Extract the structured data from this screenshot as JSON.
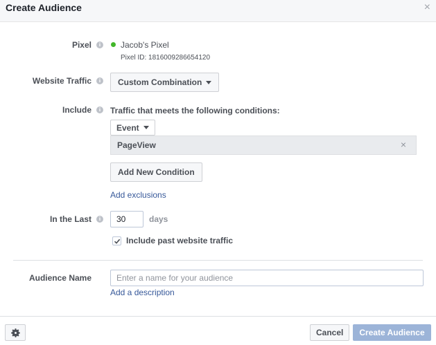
{
  "dialog": {
    "title": "Create Audience",
    "close_glyph": "×"
  },
  "pixel": {
    "label": "Pixel",
    "name": "Jacob's Pixel",
    "id_label": "Pixel ID:",
    "id_value": "1816009286654120",
    "status_color": "#42b72a"
  },
  "website_traffic": {
    "label": "Website Traffic",
    "selected": "Custom Combination"
  },
  "include": {
    "label": "Include",
    "heading": "Traffic that meets the following conditions:",
    "event_dropdown": "Event",
    "condition": "PageView",
    "remove_glyph": "×",
    "add_condition": "Add New Condition",
    "add_exclusions": "Add exclusions"
  },
  "retention": {
    "label": "In the Last",
    "value": "30",
    "unit": "days",
    "past_traffic_label": "Include past website traffic",
    "past_traffic_checked": true
  },
  "audience_name": {
    "label": "Audience Name",
    "placeholder": "Enter a name for your audience",
    "value": "",
    "add_description": "Add a description"
  },
  "footer": {
    "settings_icon": "gear-icon",
    "cancel": "Cancel",
    "create": "Create Audience"
  },
  "colors": {
    "link": "#365899",
    "primary_disabled": "#9cb4d8",
    "header_bg": "#f6f7f9"
  }
}
